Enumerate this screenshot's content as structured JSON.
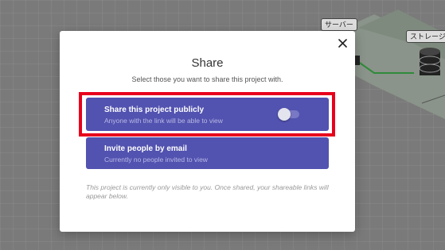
{
  "background": {
    "node_labels": [
      "サーバー",
      "ストレージ"
    ]
  },
  "modal": {
    "title": "Share",
    "subtitle": "Select those you want to share this project with.",
    "close_icon": "close-icon",
    "options": [
      {
        "title": "Share this project publicly",
        "description": "Anyone with the link will be able to view",
        "toggle_on": false
      },
      {
        "title": "Invite people by email",
        "description": "Currently no people invited to view"
      }
    ],
    "footnote": "This project is currently only visible to you. Once shared, your shareable links will appear below."
  },
  "colors": {
    "accent": "#5252b0",
    "highlight": "#e8001c",
    "overlay": "#7a7a7a"
  }
}
